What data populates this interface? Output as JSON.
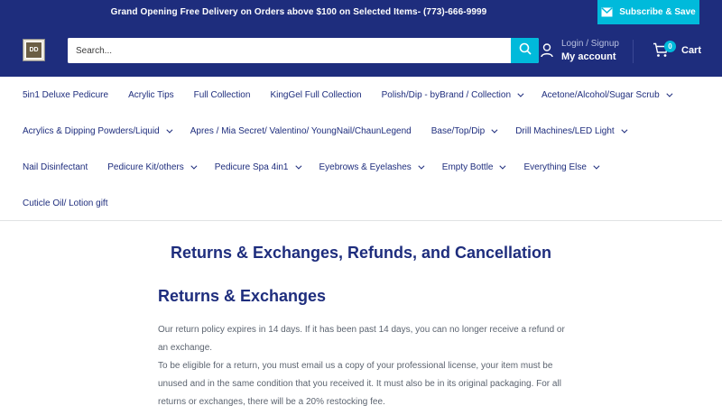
{
  "announcement": {
    "text": "Grand Opening Free Delivery on Orders above $100 on Selected Items- (773)-666-9999",
    "subscribe_label": "Subscribe & Save"
  },
  "header": {
    "logo_text": "DD",
    "search_placeholder": "Search...",
    "login_label": "Login / Signup",
    "account_label": "My account",
    "cart_count": "0",
    "cart_label": "Cart"
  },
  "nav": {
    "rows": [
      [
        {
          "label": "5in1 Deluxe Pedicure",
          "dropdown": false
        },
        {
          "label": "Acrylic Tips",
          "dropdown": false
        },
        {
          "label": "Full Collection",
          "dropdown": false
        },
        {
          "label": "KingGel Full Collection",
          "dropdown": false
        },
        {
          "label": "Polish/Dip - byBrand / Collection",
          "dropdown": true
        },
        {
          "label": "Acetone/Alcohol/Sugar Scrub",
          "dropdown": true
        }
      ],
      [
        {
          "label": "Acrylics & Dipping Powders/Liquid",
          "dropdown": true
        },
        {
          "label": "Apres / Mia Secret/ Valentino/ YoungNail/ChaunLegend",
          "dropdown": false
        },
        {
          "label": "Base/Top/Dip",
          "dropdown": true
        },
        {
          "label": "Drill Machines/LED Light",
          "dropdown": true
        }
      ],
      [
        {
          "label": "Nail Disinfectant",
          "dropdown": false
        },
        {
          "label": "Pedicure Kit/others",
          "dropdown": true
        },
        {
          "label": "Pedicure Spa 4in1",
          "dropdown": true
        },
        {
          "label": "Eyebrows & Eyelashes",
          "dropdown": true
        },
        {
          "label": "Empty Bottle",
          "dropdown": true
        },
        {
          "label": "Everything Else",
          "dropdown": true
        }
      ],
      [
        {
          "label": "Cuticle Oil/ Lotion gift",
          "dropdown": false
        }
      ]
    ]
  },
  "main": {
    "page_title": "Returns & Exchanges, Refunds, and Cancellation",
    "section_title": "Returns & Exchanges",
    "paragraph_1": "Our return policy expires in 14 days. If it has been past 14 days, you can no longer receive a refund or an exchange.",
    "paragraph_2": "To be eligible for a return, you must email us a copy of your professional license, your item must be unused and in the same condition that you received it. It must also be in its original packaging. For all returns or exchanges, there will be a 20% restocking fee."
  },
  "colors": {
    "brand": "#1e2d7d",
    "accent": "#00badb",
    "body_text": "#5c6470"
  }
}
